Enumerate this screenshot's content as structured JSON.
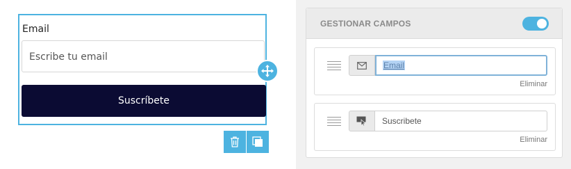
{
  "form": {
    "email_label": "Email",
    "email_placeholder": "Escribe tu email",
    "submit_label": "Suscríbete"
  },
  "panel": {
    "title": "GESTIONAR CAMPOS",
    "toggle_on": true,
    "fields": [
      {
        "icon": "envelope-icon",
        "value": "Email",
        "remove_label": "Eliminar"
      },
      {
        "icon": "cursor-click-icon",
        "value": "Suscribete",
        "remove_label": "Eliminar"
      }
    ]
  },
  "colors": {
    "accent": "#4db3e0",
    "button_dark": "#0b0b33",
    "panel_bg": "#f1f1f1"
  }
}
